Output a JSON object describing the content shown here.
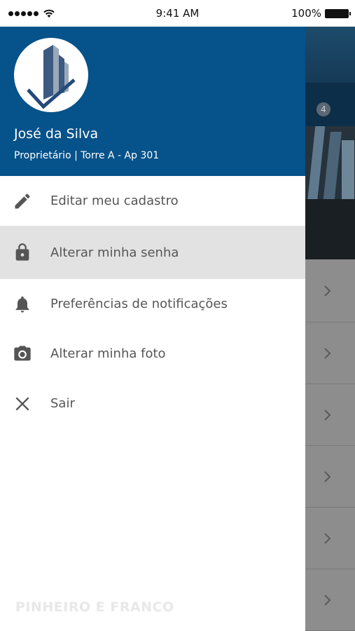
{
  "status_bar": {
    "time": "9:41 AM",
    "battery": "100%"
  },
  "drawer": {
    "user": {
      "name": "José da Silva",
      "role": "Proprietário | Torre A - Ap 301"
    },
    "menu": [
      {
        "label": "Editar meu cadastro",
        "icon": "pencil-icon"
      },
      {
        "label": "Alterar minha senha",
        "icon": "lock-icon",
        "selected": true
      },
      {
        "label": "Preferências de notificações",
        "icon": "bell-icon"
      },
      {
        "label": "Alterar minha foto",
        "icon": "camera-icon"
      },
      {
        "label": "Sair",
        "icon": "close-icon"
      }
    ],
    "footer_brand": "PINHEIRO E FRANCO"
  },
  "background_app": {
    "badge_count": "4"
  },
  "colors": {
    "drawer_header": "#06528a",
    "selected_item": "#e2e2e2",
    "icon": "#555555"
  }
}
